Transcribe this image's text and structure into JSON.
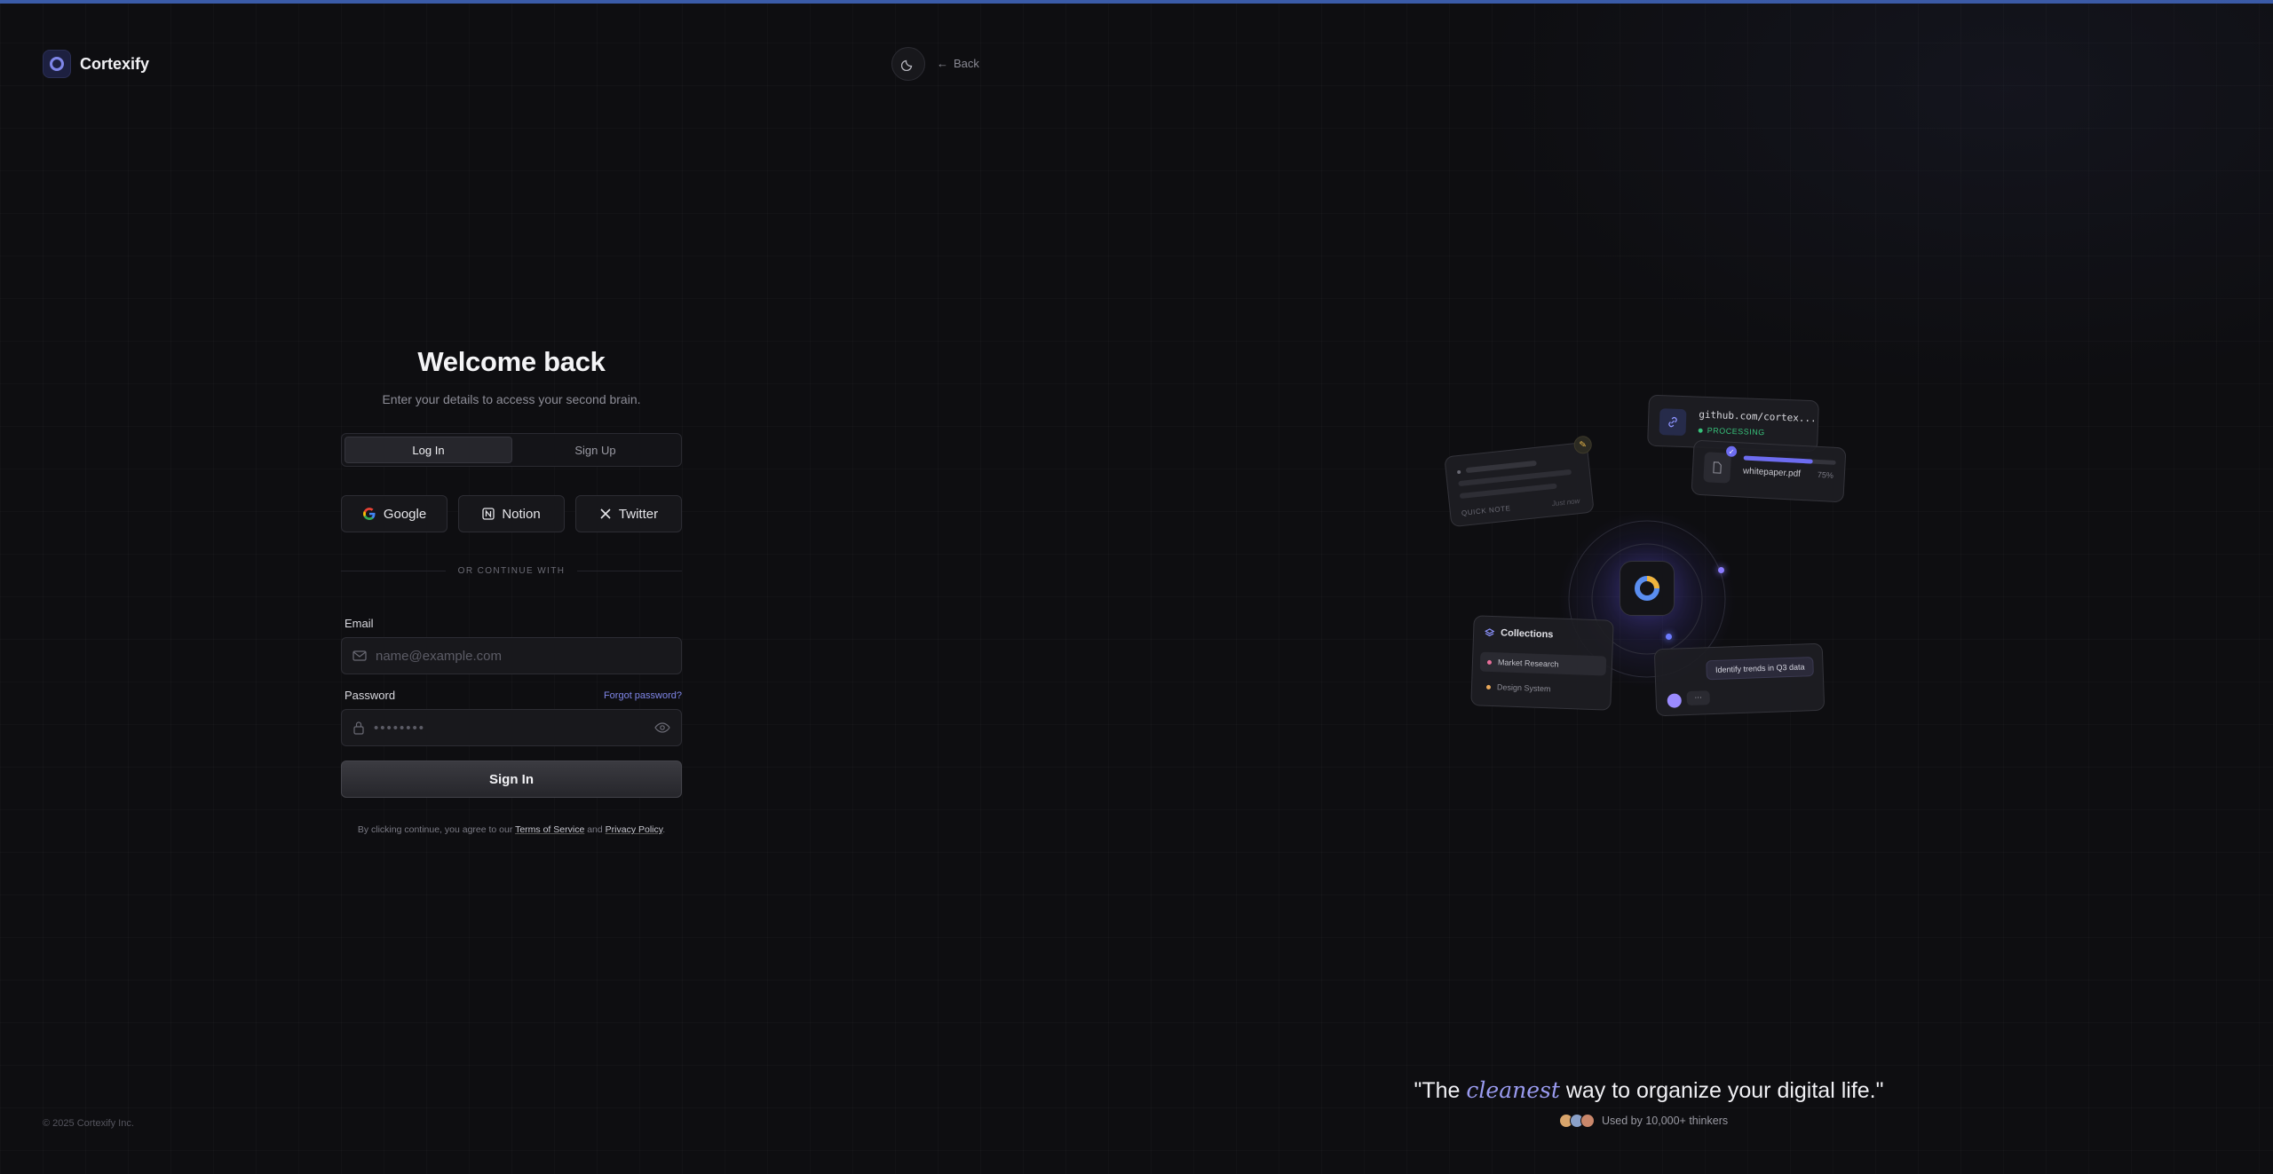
{
  "brand": {
    "name": "Cortexify"
  },
  "nav": {
    "back_label": "Back"
  },
  "form": {
    "title": "Welcome back",
    "subtitle": "Enter your details to access your second brain.",
    "tabs": [
      {
        "label": "Log In",
        "active": true
      },
      {
        "label": "Sign Up",
        "active": false
      }
    ],
    "social": [
      {
        "label": "Google",
        "icon": "google-icon"
      },
      {
        "label": "Notion",
        "icon": "notion-icon"
      },
      {
        "label": "Twitter",
        "icon": "x-icon"
      }
    ],
    "divider": "OR CONTINUE WITH",
    "email": {
      "label": "Email",
      "placeholder": "name@example.com",
      "value": ""
    },
    "password": {
      "label": "Password",
      "masked": "••••••••",
      "forgot_label": "Forgot password?"
    },
    "submit_label": "Sign In",
    "terms": {
      "prefix": "By clicking continue, you agree to our ",
      "tos": "Terms of Service",
      "mid": " and ",
      "privacy": "Privacy Policy",
      "suffix": "."
    }
  },
  "footer": {
    "copyright": "© 2025 Cortexify Inc."
  },
  "illustration": {
    "link_card": {
      "url": "github.com/cortex...",
      "status": "PROCESSING"
    },
    "file_card": {
      "filename": "whitepaper.pdf",
      "percent": "75%",
      "progress": 0.75
    },
    "note_card": {
      "label": "QUICK NOTE",
      "time": "Just now"
    },
    "collections_card": {
      "title": "Collections",
      "items": [
        {
          "label": "Market Research",
          "color": "#e96f9a"
        },
        {
          "label": "Design System",
          "color": "#e9a85a"
        }
      ]
    },
    "chat_card": {
      "prompt": "Identify trends in Q3 data",
      "typing": "..."
    }
  },
  "quote": {
    "before": "\"The ",
    "emphasis": "cleanest",
    "after": " way to organize your digital life.\"",
    "social_proof": "Used by 10,000+ thinkers"
  },
  "colors": {
    "accent": "#7f86e8",
    "status_green": "#37c17a",
    "top_bar": "#3a5ba8"
  }
}
